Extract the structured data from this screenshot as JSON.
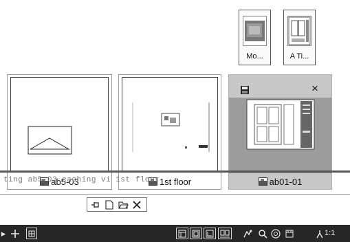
{
  "layouts": [
    {
      "label": "Mo..."
    },
    {
      "label": "A Ti..."
    }
  ],
  "drawings": [
    {
      "label": "ab5-03"
    },
    {
      "label": "1st floor"
    },
    {
      "label": "ab01-01"
    }
  ],
  "active_tab": {
    "label": "ab01-01",
    "close_glyph": "×"
  },
  "status_strip": {
    "text": "ting ab5-03 caching vi 1st floor"
  },
  "statusbar": {
    "scale_label": "1:1"
  },
  "colors": {
    "statusbar": "#262626",
    "active_tab": "#c8c8c8",
    "preview": "#9c9c9c"
  }
}
